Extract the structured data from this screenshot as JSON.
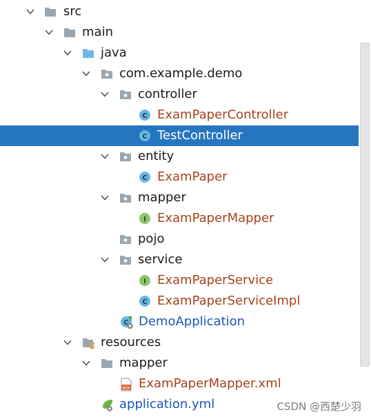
{
  "tree": {
    "items": [
      {
        "label": "src"
      },
      {
        "label": "main"
      },
      {
        "label": "java"
      },
      {
        "label": "com.example.demo"
      },
      {
        "label": "controller"
      },
      {
        "label": "ExamPaperController"
      },
      {
        "label": "TestController"
      },
      {
        "label": "entity"
      },
      {
        "label": "ExamPaper"
      },
      {
        "label": "mapper"
      },
      {
        "label": "ExamPaperMapper"
      },
      {
        "label": "pojo"
      },
      {
        "label": "service"
      },
      {
        "label": "ExamPaperService"
      },
      {
        "label": "ExamPaperServiceImpl"
      },
      {
        "label": "DemoApplication"
      },
      {
        "label": "resources"
      },
      {
        "label": "mapper"
      },
      {
        "label": "ExamPaperMapper.xml"
      },
      {
        "label": "application.yml"
      }
    ]
  },
  "colors": {
    "selection": "#2675bf",
    "class_name": "#a5421c",
    "main_class": "#1b55b6",
    "folder_gray": "#9aa7b0",
    "folder_source": "#6fb7e6",
    "class_icon": "#67b6e3",
    "interface_icon": "#8cc56b"
  },
  "icons": {
    "folder": "folder-icon",
    "source_folder": "source-folder-icon",
    "package": "package-icon",
    "class": "class-icon",
    "interface": "interface-icon",
    "spring_boot": "spring-boot-app-icon",
    "resources": "resources-folder-icon",
    "xml": "xml-file-icon",
    "yml": "yml-file-icon"
  },
  "watermark": "CSDN @西楚少羽"
}
